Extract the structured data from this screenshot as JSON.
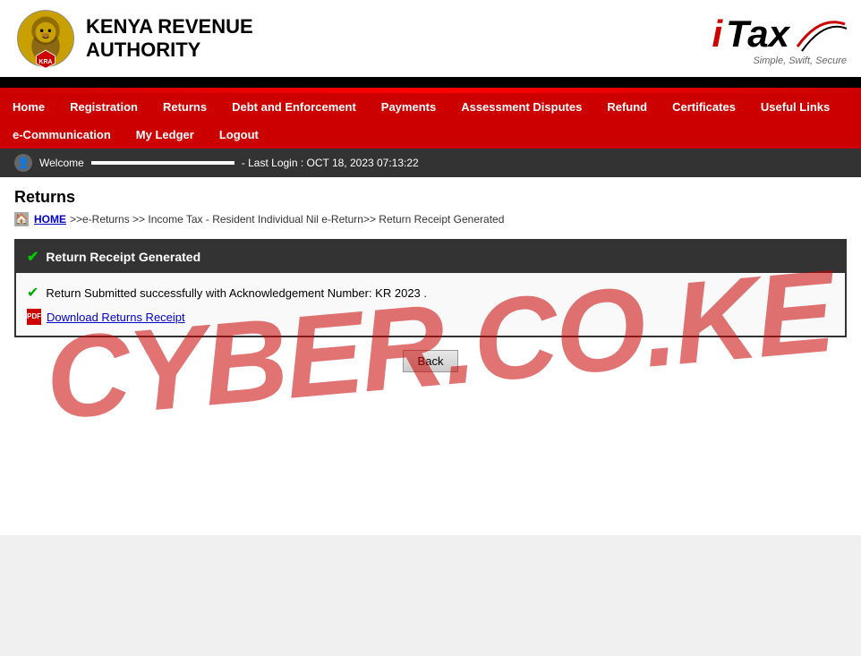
{
  "header": {
    "kra_name_line1": "Kenya Revenue",
    "kra_name_line2": "Authority",
    "itax_brand": "iTax",
    "itax_tagline": "Simple, Swift, Secure"
  },
  "nav": {
    "items_row1": [
      {
        "label": "Home",
        "name": "home"
      },
      {
        "label": "Registration",
        "name": "registration"
      },
      {
        "label": "Returns",
        "name": "returns"
      },
      {
        "label": "Debt and Enforcement",
        "name": "debt-and-enforcement"
      },
      {
        "label": "Payments",
        "name": "payments"
      },
      {
        "label": "Assessment Disputes",
        "name": "assessment-disputes"
      },
      {
        "label": "Refund",
        "name": "refund"
      },
      {
        "label": "Certificates",
        "name": "certificates"
      },
      {
        "label": "Useful Links",
        "name": "useful-links"
      }
    ],
    "items_row2": [
      {
        "label": "e-Communication",
        "name": "e-communication"
      },
      {
        "label": "My Ledger",
        "name": "my-ledger"
      },
      {
        "label": "Logout",
        "name": "logout"
      }
    ]
  },
  "welcome_bar": {
    "welcome_label": "Welcome",
    "user_name": "",
    "last_login_text": "- Last Login : OCT 18, 2023 07:13:22"
  },
  "page": {
    "title": "Returns",
    "breadcrumb_home": "HOME",
    "breadcrumb_path": ">>e-Returns >> Income Tax - Resident Individual Nil e-Return>> Return Receipt Generated"
  },
  "receipt": {
    "header_title": "Return Receipt Generated",
    "success_message": "Return Submitted successfully with Acknowledgement Number: KR  2023  .",
    "download_label": "Download Returns Receipt",
    "back_button": "Back"
  },
  "watermark": {
    "text": "CYBER.CO.KE"
  }
}
